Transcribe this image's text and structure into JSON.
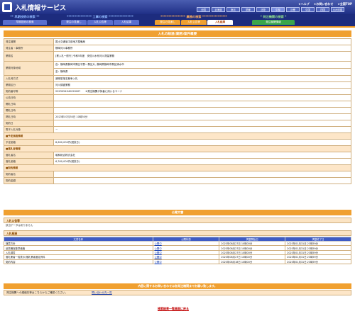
{
  "header": {
    "title": "入札情報サービス",
    "links": [
      "★ヘルプ",
      "★お問い合わせ",
      "★全国TOP"
    ],
    "regions": [
      "全国",
      "北海道",
      "東北",
      "関東",
      "北陸",
      "中部",
      "近畿",
      "中国",
      "四国",
      "九州沖縄"
    ]
  },
  "nav": {
    "groups": [
      {
        "title": "** 早期技術の検索 **",
        "tabs": [
          "早期技術の検索"
        ]
      },
      {
        "title": "**************** 工事の検索 ****************",
        "tabs": [
          "発注の見通し",
          "入札公告等",
          "入札結果"
        ]
      },
      {
        "title": "**************** 業務の検索 ****************",
        "tabs": [
          "発注の見通し",
          "入札公告等",
          "入札結果"
        ]
      },
      {
        "title": "* 発注機関の検索 *",
        "tabs": [
          "発注機関情報"
        ]
      }
    ]
  },
  "page_title": "入札の経過(業務)案件概要",
  "details": [
    {
      "label": "発注機関",
      "value": "国土交通省中部地方整備局"
    },
    {
      "label": "発注者・事務所",
      "value": "静岡河川事務所"
    },
    {
      "label": "業務名",
      "value": "[業入札一般行] 令和5年度　安倍川水系河川測量業務"
    },
    {
      "label": "業務対象地域",
      "value": "自：静岡県静岡市葵区平野～葵区片, 静岡県静岡市葵区清水市"
    },
    {
      "label": "",
      "value": "至：静岡県"
    },
    {
      "label": "入札時方式",
      "value": "通常型指名競争入札"
    },
    {
      "label": "業務区分",
      "value": "河川調査業務"
    },
    {
      "label": "契約番号等",
      "value": "202305494202000?　　※発注機関が採番に用いるコード"
    },
    {
      "label": "公告日時",
      "value": ""
    },
    {
      "label": "開札日時",
      "value": ""
    },
    {
      "label": "開札日時",
      "value": ""
    },
    {
      "label": "掲札日時",
      "value": "2023年07月30日 10時30分"
    },
    {
      "label": "契約日",
      "value": ""
    },
    {
      "label": "電子入札対象",
      "value": "－"
    }
  ],
  "price_section": {
    "title": "■予定価格情報",
    "rows": [
      {
        "label": "予定価格",
        "value": "8,600,000円(税抜き)"
      }
    ]
  },
  "winner_section": {
    "title": "■落札者情報",
    "rows": [
      {
        "label": "落札者名",
        "value": "昭和総合株式会社"
      },
      {
        "label": "落札価格",
        "value": "6,300,000円(税抜き)"
      }
    ]
  },
  "contract_section": {
    "title": "■契約情報",
    "rows": [
      {
        "label": "契約者名",
        "value": ""
      },
      {
        "label": "契約金額",
        "value": ""
      }
    ]
  },
  "docs": {
    "title": "公開文書",
    "notice_head": "入札公告等",
    "notice_none": "該当データはありません",
    "process_head": "入札経過",
    "columns": [
      "文書名称",
      "公開状態",
      "掲載開始日",
      "掲載終了日"
    ],
    "rows": [
      {
        "name": "随意方針",
        "status": "公開中",
        "start": "2023年08月27日 10時00分",
        "end": "2023年01月31日 23時59分"
      },
      {
        "name": "品質確保基準価格",
        "status": "公開中",
        "start": "2023年08月27日 10時00分",
        "end": "2023年01月31日 23時59分"
      },
      {
        "name": "入札調書",
        "status": "公開中",
        "start": "2023年08月27日 10時00分",
        "end": "2023年01月31日 23時59分"
      },
      {
        "name": "落札業者一覧表示(落札業者選定資料",
        "status": "公開中",
        "start": "2023年08月27日 10時00分",
        "end": "2023年01月31日 23時59分"
      },
      {
        "name": "契約内容",
        "status": "公開中",
        "start": "2023年08月18日 10時00分",
        "end": "2023年01月31日 23時59分"
      }
    ]
  },
  "inquiry": {
    "bar": "内容に関するお問い合わせは各発注機関までお願い致します。",
    "label": "発注機関への連絡先等はこちらからご確認ください。",
    "link": "問い合わせ先一覧"
  },
  "back_link": "検索結果一覧画面に戻る",
  "colors": {
    "brand": "#1f2f86",
    "accent": "#f0a030",
    "row_label": "#fbe4c4"
  }
}
